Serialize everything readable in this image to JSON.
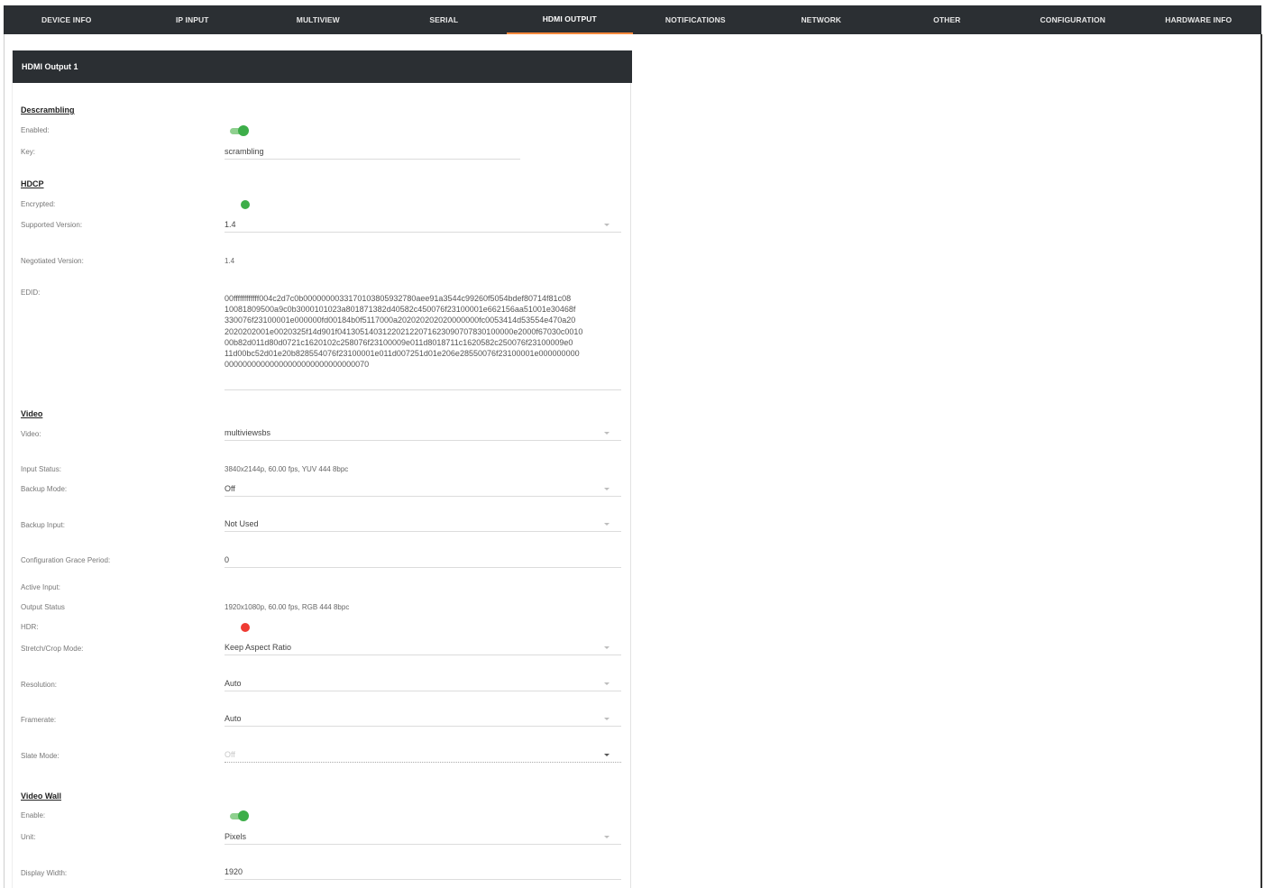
{
  "tabs": [
    {
      "label": "DEVICE INFO"
    },
    {
      "label": "IP INPUT"
    },
    {
      "label": "MULTIVIEW"
    },
    {
      "label": "SERIAL"
    },
    {
      "label": "HDMI OUTPUT"
    },
    {
      "label": "NOTIFICATIONS"
    },
    {
      "label": "NETWORK"
    },
    {
      "label": "OTHER"
    },
    {
      "label": "CONFIGURATION"
    },
    {
      "label": "HARDWARE INFO"
    }
  ],
  "active_tab": "HDMI OUTPUT",
  "card": {
    "title": "HDMI Output 1"
  },
  "descrambling": {
    "title": "Descrambling",
    "enabled_label": "Enabled:",
    "enabled": true,
    "key_label": "Key:",
    "key_value": "scrambling"
  },
  "hdcp": {
    "title": "HDCP",
    "encrypted_label": "Encrypted:",
    "encrypted_status_color": "#3dae49",
    "supported_label": "Supported Version:",
    "supported_value": "1.4",
    "negotiated_label": "Negotiated Version:",
    "negotiated_value": "1.4",
    "edid_label": "EDID:",
    "edid_lines": [
      "00ffffffffffff004c2d7c0b0000000033170103805932780aee91a3544c99260f5054bdef80714f81c08",
      "10081809500a9c0b3000101023a801871382d40582c450076f23100001e662156aa51001e30468f",
      "330076f23100001e000000fd00184b0f5117000a202020202020000000fc0053414d53554e470a20",
      "2020202001e0020325f14d901f041305140312202122071623090707830100000e2000f67030c0010",
      "00b82d011d80d0721c1620102c258076f23100009e011d8018711c1620582c250076f23100009e0",
      "11d00bc52d01e20b828554076f23100001e011d007251d01e206e28550076f23100001e000000000",
      "00000000000000000000000000000070"
    ]
  },
  "video": {
    "title": "Video",
    "video_label": "Video:",
    "video_value": "multiviewsbs",
    "input_status_label": "Input Status:",
    "input_status_value": "3840x2144p, 60.00 fps, YUV 444 8bpc",
    "backup_mode_label": "Backup Mode:",
    "backup_mode_value": "Off",
    "backup_input_label": "Backup Input:",
    "backup_input_value": "Not Used",
    "grace_label": "Configuration Grace Period:",
    "grace_value": "0",
    "active_input_label": "Active Input:",
    "output_status_label": "Output Status",
    "output_status_value": "1920x1080p, 60.00 fps, RGB 444 8bpc",
    "hdr_label": "HDR:",
    "hdr_status_color": "#ef3b33",
    "stretch_label": "Stretch/Crop Mode:",
    "stretch_value": "Keep Aspect Ratio",
    "resolution_label": "Resolution:",
    "resolution_value": "Auto",
    "framerate_label": "Framerate:",
    "framerate_value": "Auto",
    "slate_label": "Slate Mode:",
    "slate_value": "Off"
  },
  "video_wall": {
    "title": "Video Wall",
    "enable_label": "Enable:",
    "enabled": true,
    "unit_label": "Unit:",
    "unit_value": "Pixels",
    "display_width_label": "Display Width:",
    "display_width_value": "1920"
  },
  "colors": {
    "nav_bg": "#2b2f33",
    "active_tab_underline": "#ff8a3d",
    "toggle_on": "#3dae49"
  }
}
